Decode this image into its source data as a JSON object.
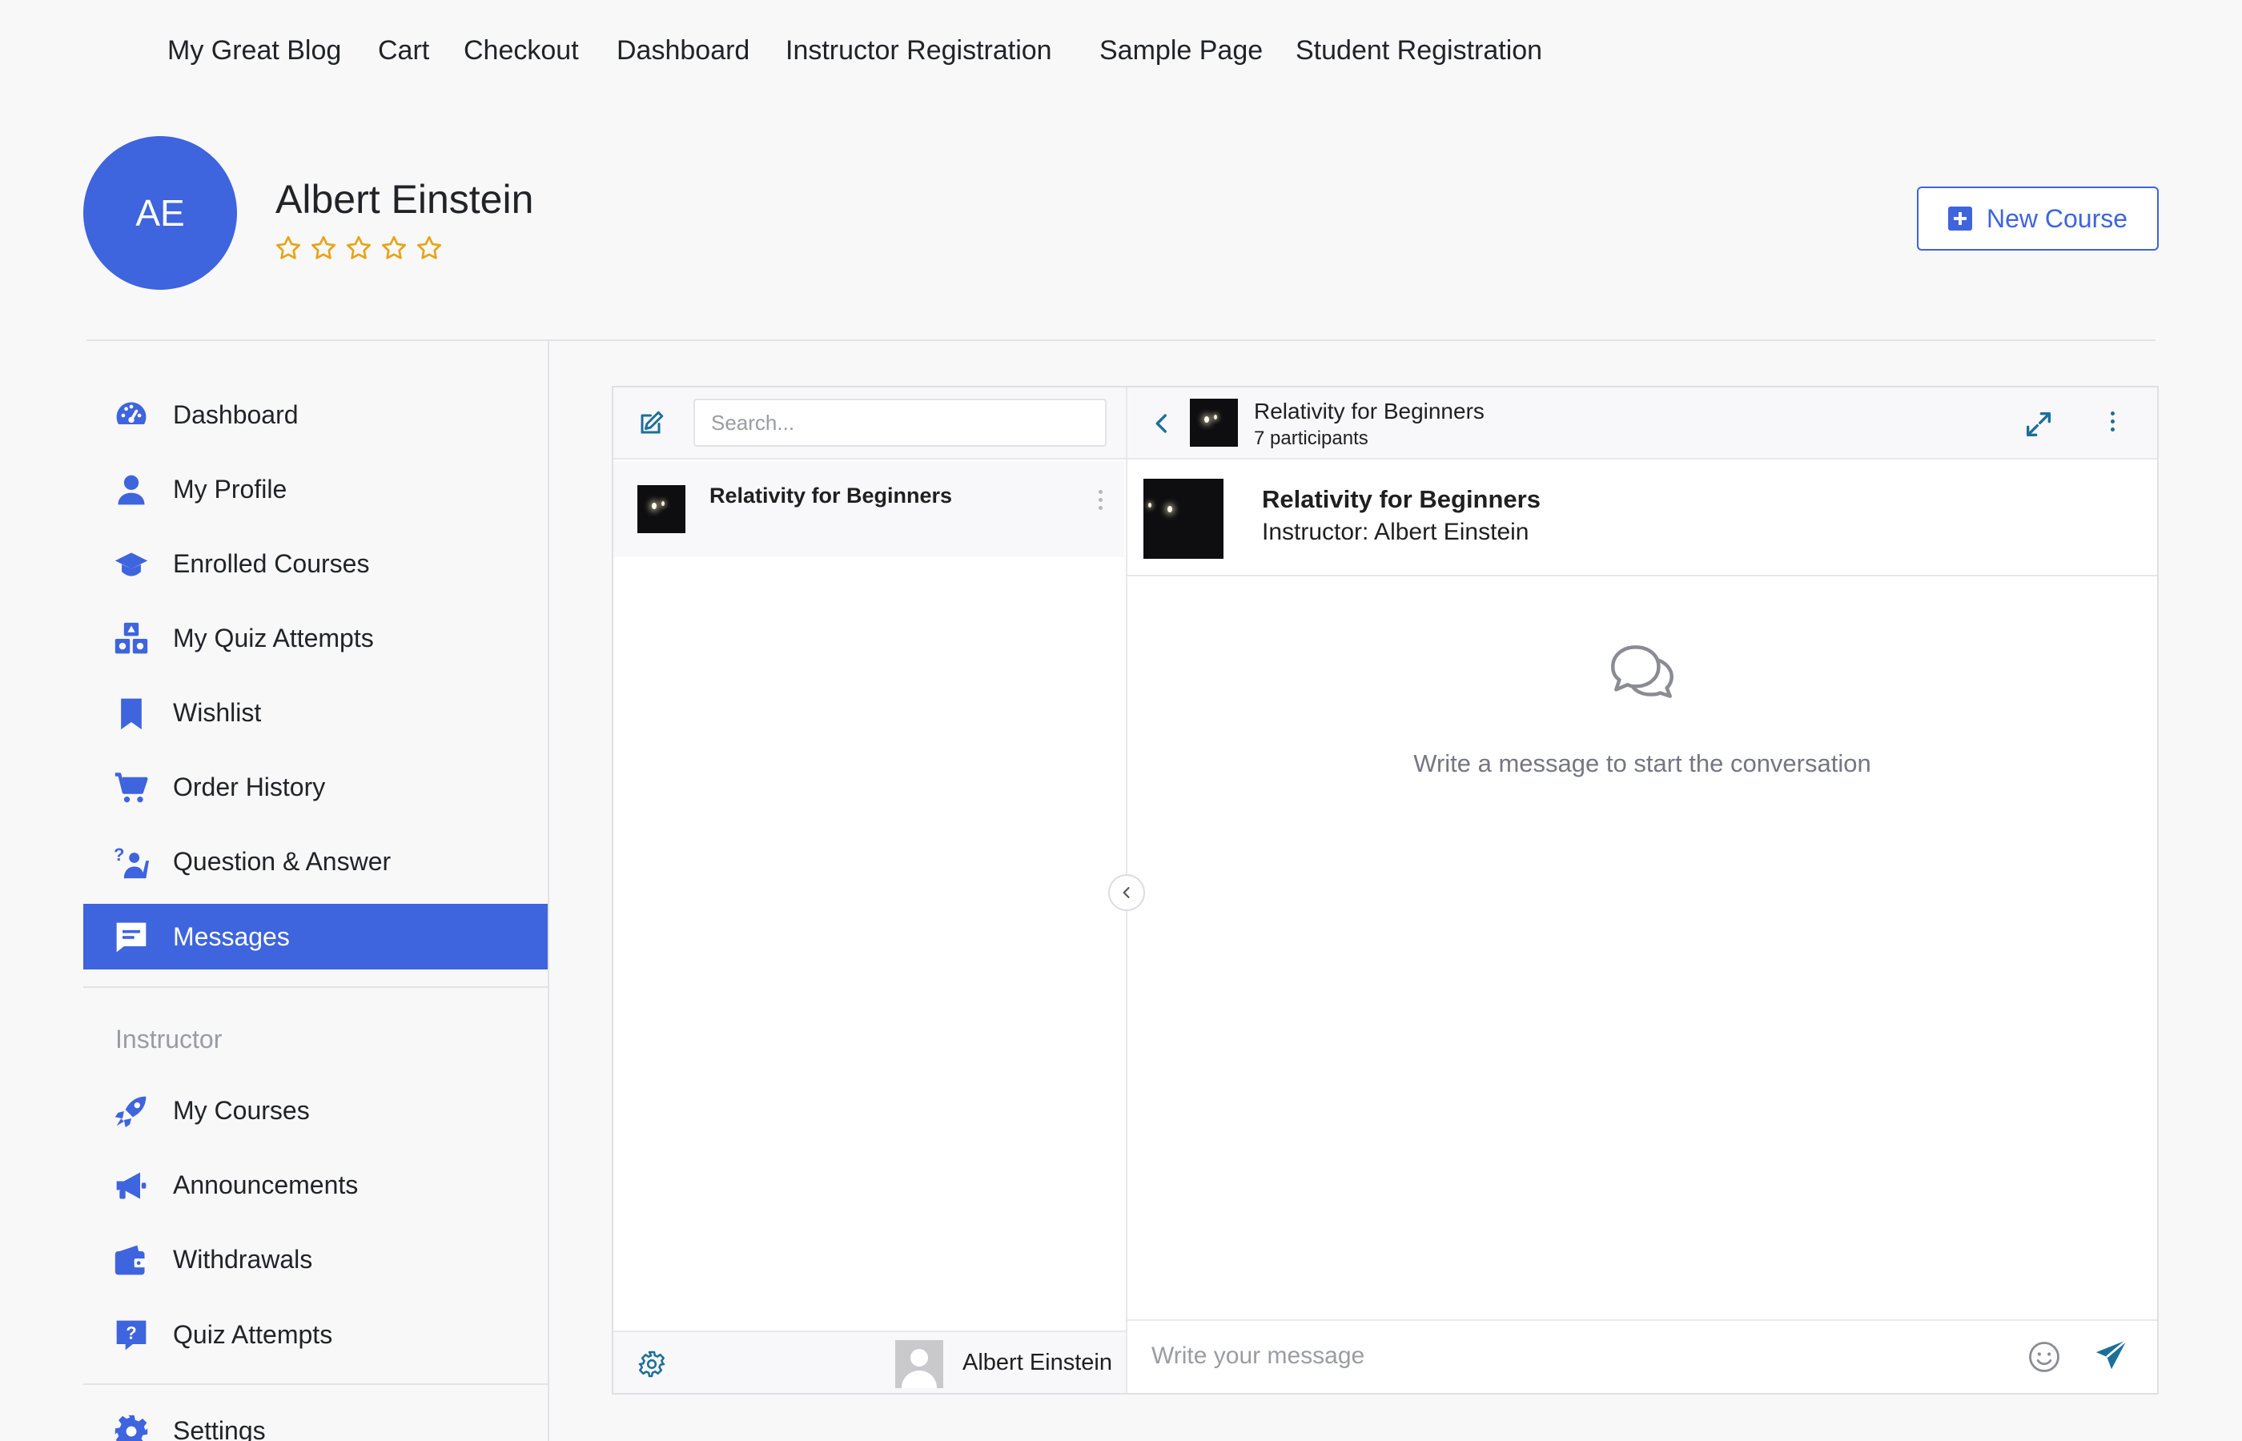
{
  "topnav": {
    "items": [
      "My Great Blog",
      "Cart",
      "Checkout",
      "Dashboard",
      "Instructor Registration",
      "Sample Page",
      "Student Registration"
    ]
  },
  "profile": {
    "initials": "AE",
    "name": "Albert Einstein",
    "rating": 0,
    "rating_max": 5
  },
  "actions": {
    "new_course": "New Course"
  },
  "sidebar": {
    "items": [
      {
        "label": "Dashboard",
        "icon": "dashboard-gauge-icon"
      },
      {
        "label": "My Profile",
        "icon": "user-icon"
      },
      {
        "label": "Enrolled Courses",
        "icon": "graduation-cap-icon"
      },
      {
        "label": "My Quiz Attempts",
        "icon": "shapes-blocks-icon"
      },
      {
        "label": "Wishlist",
        "icon": "bookmark-icon"
      },
      {
        "label": "Order History",
        "icon": "cart-icon"
      },
      {
        "label": "Question & Answer",
        "icon": "question-person-icon"
      },
      {
        "label": "Messages",
        "icon": "message-icon",
        "active": true
      }
    ],
    "instructor_heading": "Instructor",
    "instructor_items": [
      {
        "label": "My Courses",
        "icon": "rocket-icon"
      },
      {
        "label": "Announcements",
        "icon": "megaphone-icon"
      },
      {
        "label": "Withdrawals",
        "icon": "wallet-icon"
      },
      {
        "label": "Quiz Attempts",
        "icon": "question-box-icon"
      }
    ],
    "settings": {
      "label": "Settings",
      "icon": "gear-icon"
    }
  },
  "messages": {
    "search_placeholder": "Search...",
    "conversations": [
      {
        "title": "Relativity for Beginners"
      }
    ],
    "header": {
      "title": "Relativity for Beginners",
      "participants": "7 participants"
    },
    "course_card": {
      "title": "Relativity for Beginners",
      "instructor": "Instructor: Albert Einstein"
    },
    "empty_state": "Write a message to start the conversation",
    "current_user": "Albert Einstein",
    "input_placeholder": "Write your message"
  },
  "colors": {
    "accent": "#3e64de",
    "star": "#e8a317",
    "icon_teal": "#1d6f99"
  }
}
